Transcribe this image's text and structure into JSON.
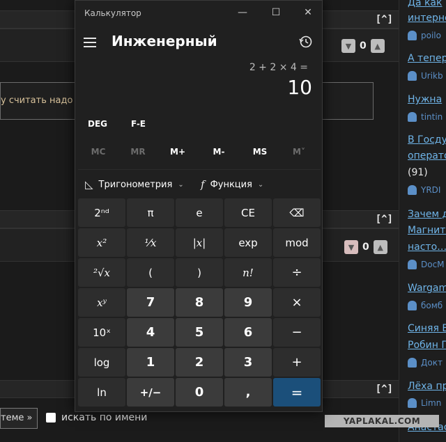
{
  "forum": {
    "collapse_top": "[^]",
    "collapse_mid": "[^]",
    "collapse_bottom": "[^]",
    "vote_count_1": "0",
    "vote_count_2": "0",
    "input_text": "у считать надо",
    "bottom_button": "теме »",
    "search_by_name_label": "искать по имени"
  },
  "sidebar": {
    "items": [
      {
        "title": "Да как",
        "title2": "интерне"
      },
      {
        "user": "poilo"
      },
      {
        "title": "А тепер"
      },
      {
        "user": "Urikb"
      },
      {
        "title": "Нужна"
      },
      {
        "user": "tintin"
      },
      {
        "title": "В Госду",
        "title2": "операто",
        "count": "(91)"
      },
      {
        "user": "YRDI"
      },
      {
        "title": "Зачем д",
        "title2": "Магнито",
        "title3": "насто…"
      },
      {
        "user": "DocM"
      },
      {
        "title": "Wargam"
      },
      {
        "user": "бомб"
      },
      {
        "title": "Синяя Е",
        "title2": "Робин Г"
      },
      {
        "user": "Докт"
      },
      {
        "title": "Лёха пр"
      },
      {
        "user": "Limn"
      },
      {
        "title": "Анастас"
      }
    ]
  },
  "watermark": "YAPLAKAL.COM",
  "calculator": {
    "window_title": "Калькулятор",
    "mode": "Инженерный",
    "expression": "2 + 2 × 4 =",
    "result": "10",
    "angle_unit": "DEG",
    "fe": "F-E",
    "memory": [
      "MC",
      "MR",
      "M+",
      "M-",
      "MS",
      "M˅"
    ],
    "trig_label": "Тригонометрия",
    "func_label": "Функция",
    "keys": {
      "second": "2ⁿᵈ",
      "pi": "π",
      "e": "e",
      "ce": "CE",
      "backspace": "⌫",
      "square": "x²",
      "reciprocal": "¹⁄x",
      "abs": "|x|",
      "exp": "exp",
      "mod": "mod",
      "sqrt": "²√x",
      "lparen": "(",
      "rparen": ")",
      "factorial": "n!",
      "divide": "÷",
      "pow": "xʸ",
      "seven": "7",
      "eight": "8",
      "nine": "9",
      "multiply": "×",
      "ten_pow": "10ˣ",
      "four": "4",
      "five": "5",
      "six": "6",
      "minus": "−",
      "log": "log",
      "one": "1",
      "two": "2",
      "three": "3",
      "plus": "+",
      "ln": "ln",
      "negate": "+/−",
      "zero": "0",
      "decimal": ",",
      "equals": "="
    },
    "colors": {
      "equals": "#1b4f7a",
      "number_key": "#3b3b3b",
      "function_key": "#2d2d2d"
    }
  }
}
